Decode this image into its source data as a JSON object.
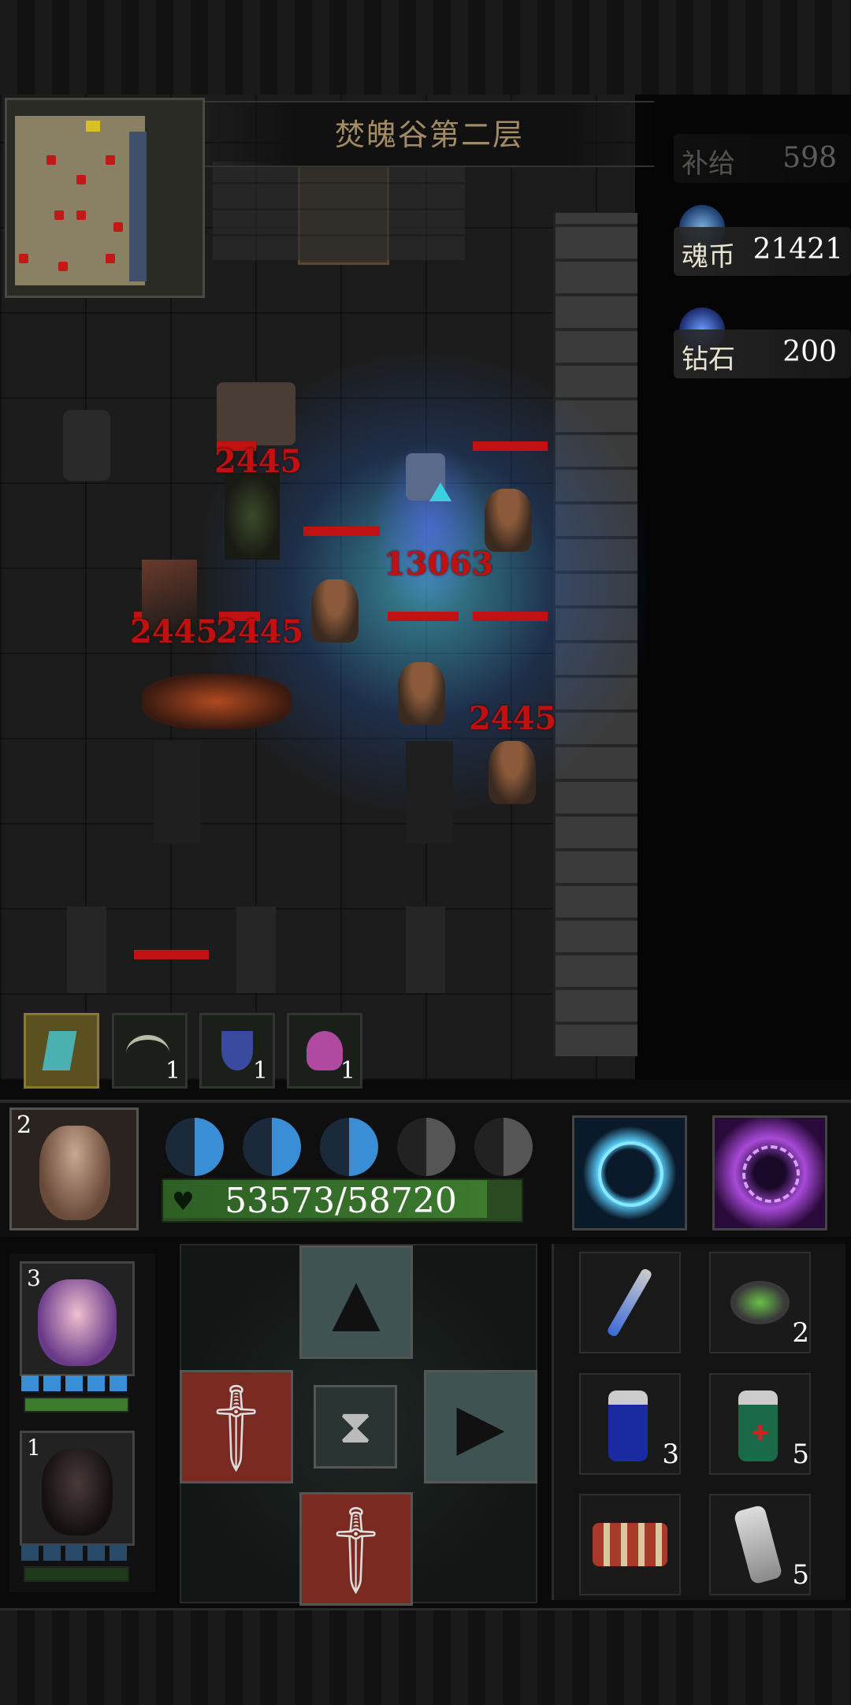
{
  "floor_title": "焚魄谷第二层",
  "currencies": [
    {
      "label": "补给",
      "value": "598",
      "icon": "supply-icon",
      "dim": true
    },
    {
      "label": "魂币",
      "value": "21421",
      "icon": "soul-coin-icon",
      "dim": false
    },
    {
      "label": "钻石",
      "value": "200",
      "icon": "diamond-icon",
      "dim": false
    }
  ],
  "damage_numbers": [
    "2445",
    "13063",
    "2445",
    "2445",
    "2445"
  ],
  "skill_slots": [
    {
      "icon": "boots-icon",
      "count": ""
    },
    {
      "icon": "crossbow-icon",
      "count": "1"
    },
    {
      "icon": "shield-icon",
      "count": "1"
    },
    {
      "icon": "skull-icon",
      "count": "1"
    }
  ],
  "hero": {
    "level": "2",
    "hp_text": "53573/58720",
    "hp_fraction": 0.912,
    "energy_full": 3,
    "energy_total": 5
  },
  "spells": [
    {
      "icon": "lightning-ring-icon"
    },
    {
      "icon": "vortex-icon"
    }
  ],
  "party": [
    {
      "level": "3",
      "icon": "tap-girl-avatar",
      "energy": 5
    },
    {
      "level": "1",
      "icon": "dark-boy-avatar",
      "energy": 5
    }
  ],
  "items": [
    {
      "icon": "blue-potion-vial-icon",
      "count": ""
    },
    {
      "icon": "herb-jar-icon",
      "count": "2"
    },
    {
      "icon": "blue-bottle-icon",
      "count": "3"
    },
    {
      "icon": "red-cross-bottle-icon",
      "count": "5"
    },
    {
      "icon": "scroll-bundle-icon",
      "count": ""
    },
    {
      "icon": "bone-totem-icon",
      "count": "5"
    }
  ],
  "colors": {
    "damage": "#c01010",
    "hp_bar": "#3c7a2e",
    "energy": "#3a8ed6",
    "title_gold": "#a48c62"
  }
}
